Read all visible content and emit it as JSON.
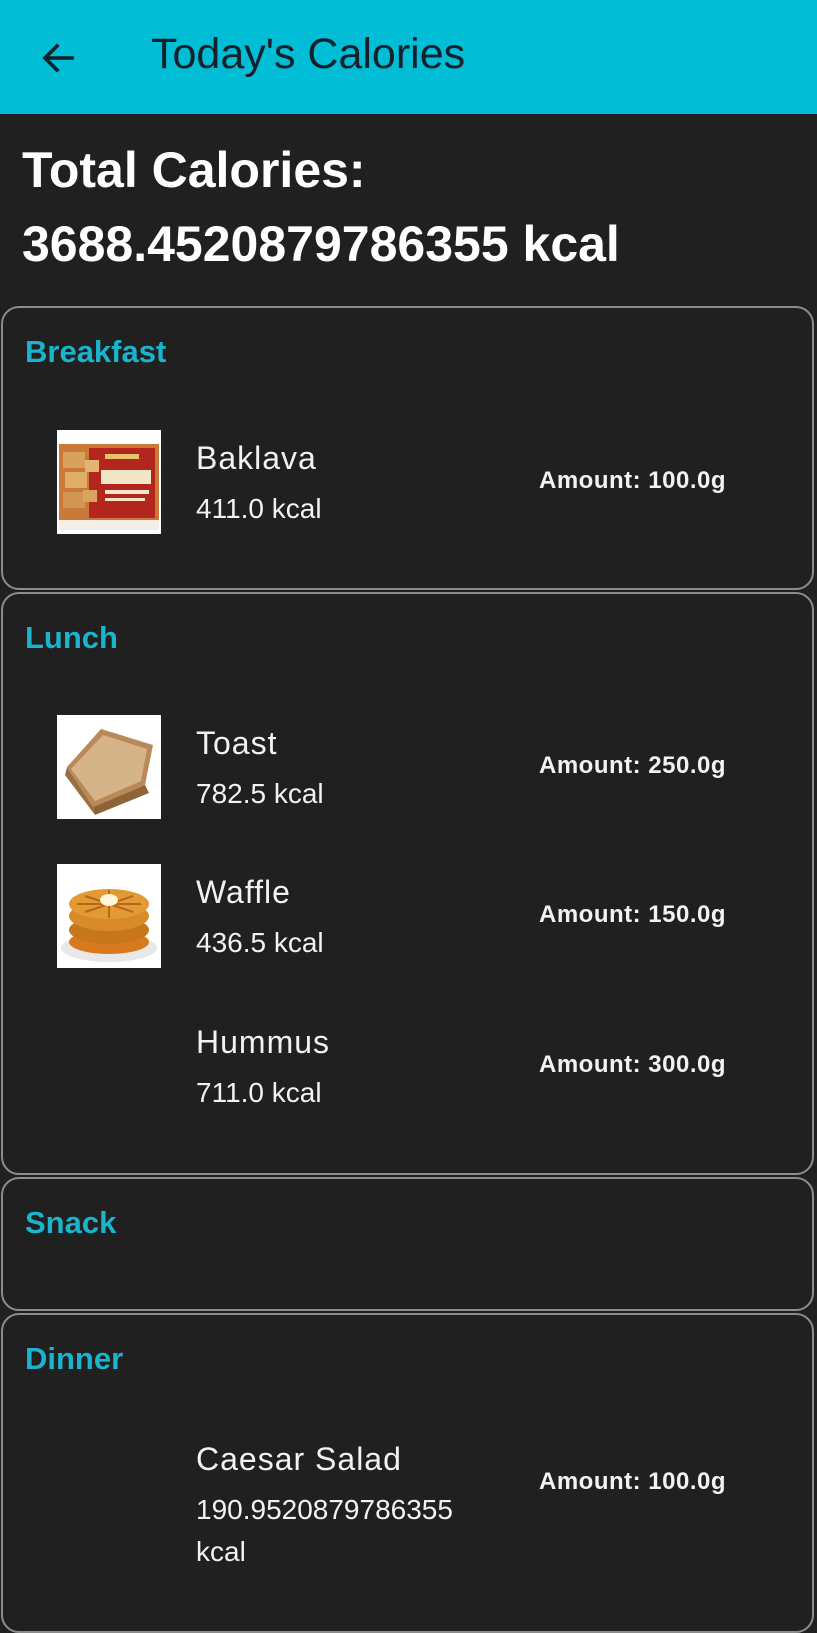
{
  "app_bar": {
    "title": "Today's Calories",
    "back_icon": "arrow-left-icon",
    "background": "#00bcd4"
  },
  "total": {
    "text": "Total Calories: 3688.4520879786355 kcal"
  },
  "accent_color": "#1ab4cc",
  "meals": [
    {
      "title": "Breakfast",
      "foods": [
        {
          "name": "Baklava",
          "kcal": "411.0 kcal",
          "amount": "Amount: 100.0g",
          "image": "baklava-image"
        }
      ]
    },
    {
      "title": "Lunch",
      "foods": [
        {
          "name": "Toast",
          "kcal": "782.5 kcal",
          "amount": "Amount: 250.0g",
          "image": "toast-image"
        },
        {
          "name": "Waffle",
          "kcal": "436.5 kcal",
          "amount": "Amount: 150.0g",
          "image": "waffle-image"
        },
        {
          "name": "Hummus",
          "kcal": "711.0 kcal",
          "amount": "Amount: 300.0g",
          "image": ""
        }
      ]
    },
    {
      "title": "Snack",
      "foods": []
    },
    {
      "title": "Dinner",
      "foods": [
        {
          "name": "Caesar Salad",
          "kcal": "190.9520879786355 kcal",
          "amount": "Amount: 100.0g",
          "image": ""
        }
      ]
    }
  ]
}
